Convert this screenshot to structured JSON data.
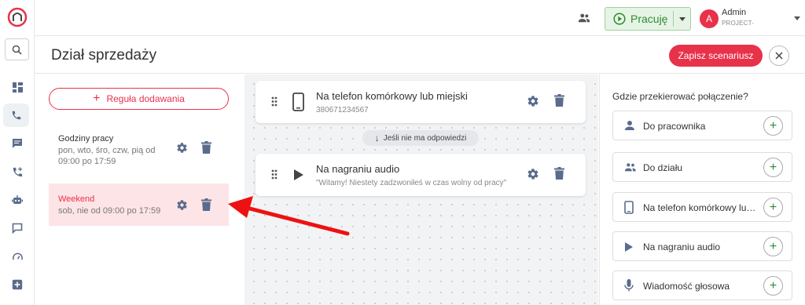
{
  "header": {
    "status_label": "Pracuję",
    "user_initial": "A",
    "user_name": "Admin",
    "user_org": "PROJECT-"
  },
  "page": {
    "title": "Dział sprzedaży",
    "save_label": "Zapisz scenariusz"
  },
  "rules": {
    "add_label": "Reguła dodawania",
    "items": [
      {
        "name": "Godziny pracy",
        "desc": "pon, wto, śro, czw, pią od 09:00 po 17:59"
      },
      {
        "name": "Weekend",
        "desc": "sob, nie od 09:00 po 17:59"
      }
    ]
  },
  "flow": {
    "steps": [
      {
        "title": "Na telefon komórkowy lub miejski",
        "sub": "380671234567",
        "icon": "phone-icon"
      },
      {
        "title": "Na nagraniu audio",
        "sub": "\"Witamy! Niestety zadzwoniłeś w czas wolny od pracy\"",
        "icon": "play-icon"
      }
    ],
    "no_answer_label": "Jeśli nie ma odpowiedzi"
  },
  "destinations": {
    "header": "Gdzie przekierować połączenie?",
    "items": [
      {
        "label": "Do pracownika",
        "icon": "person-icon"
      },
      {
        "label": "Do działu",
        "icon": "group-icon"
      },
      {
        "label": "Na telefon komórkowy lub miejski",
        "icon": "phone-icon"
      },
      {
        "label": "Na nagraniu audio",
        "icon": "play-icon"
      },
      {
        "label": "Wiadomość głosowa",
        "icon": "microphone-icon"
      }
    ]
  },
  "colors": {
    "accent": "#e8324a",
    "status_green": "#2e8b2e",
    "highlight_rule_bg": "#fde4e7"
  }
}
